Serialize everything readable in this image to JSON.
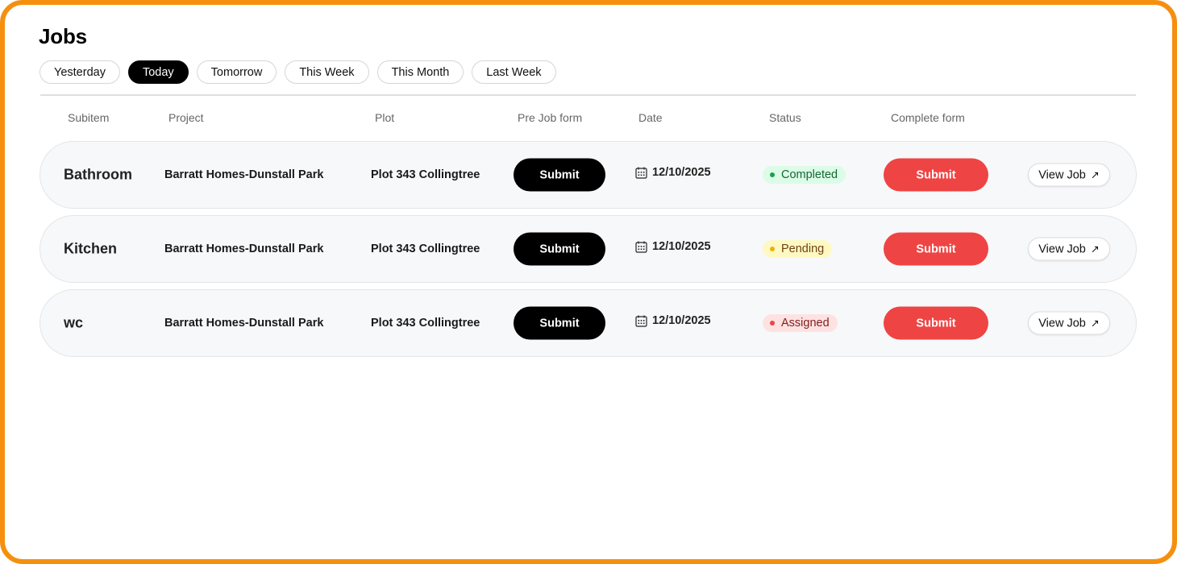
{
  "page": {
    "title": "Jobs"
  },
  "filters": [
    {
      "label": "Yesterday",
      "active": false
    },
    {
      "label": "Today",
      "active": true
    },
    {
      "label": "Tomorrow",
      "active": false
    },
    {
      "label": "This Week",
      "active": false
    },
    {
      "label": "This Month",
      "active": false
    },
    {
      "label": "Last Week",
      "active": false
    }
  ],
  "columns": {
    "subitem": "Subitem",
    "project": "Project",
    "plot": "Plot",
    "prejob": "Pre Job form",
    "date": "Date",
    "status": "Status",
    "complete": "Complete form"
  },
  "rows": [
    {
      "subitem": "Bathroom",
      "project": "Barratt Homes-Dunstall Park",
      "plot": "Plot 343 Collingtree",
      "prejob_label": "Submit",
      "date": "12/10/2025",
      "status": "Completed",
      "status_colors": {
        "bg": "#dcfce7",
        "text": "#166534",
        "dot": "#16a34a"
      },
      "complete_label": "Submit",
      "view_label": "View Job",
      "view_icon": "↗"
    },
    {
      "subitem": "Kitchen",
      "project": "Barratt Homes-Dunstall Park",
      "plot": "Plot 343 Collingtree",
      "prejob_label": "Submit",
      "date": "12/10/2025",
      "status": "Pending",
      "status_colors": {
        "bg": "#fef9c3",
        "text": "#713f12",
        "dot": "#eab308"
      },
      "complete_label": "Submit",
      "view_label": "View Job",
      "view_icon": "↗"
    },
    {
      "subitem": "wc",
      "project": "Barratt Homes-Dunstall Park",
      "plot": "Plot 343 Collingtree",
      "prejob_label": "Submit",
      "date": "12/10/2025",
      "status": "Assigned",
      "status_colors": {
        "bg": "#fee2e2",
        "text": "#7f1d1d",
        "dot": "#ef4444"
      },
      "complete_label": "Submit",
      "view_label": "View Job",
      "view_icon": "↗"
    }
  ],
  "colors": {
    "frame_border": "#f5900f",
    "primary_button": "#000000",
    "danger_button": "#ef4444"
  }
}
